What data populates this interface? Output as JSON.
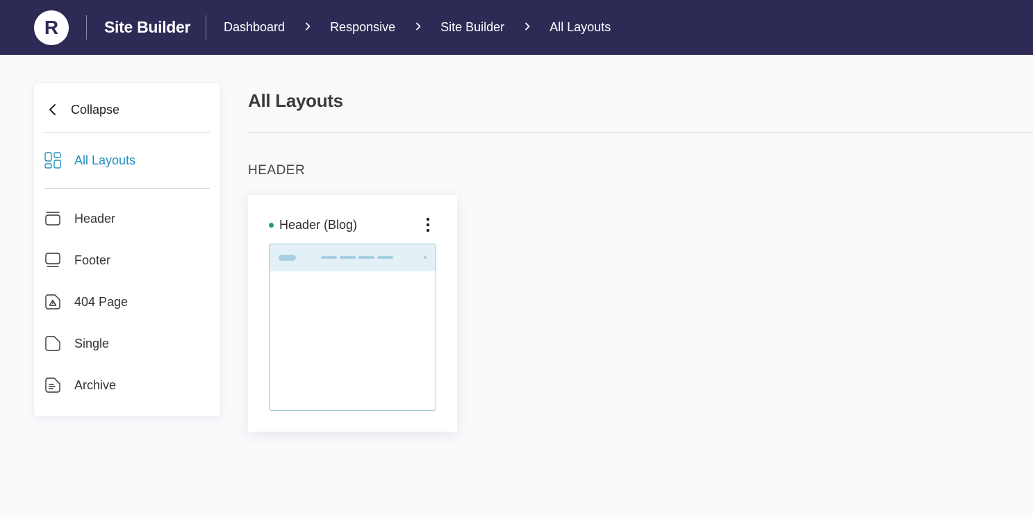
{
  "topbar": {
    "logo_letter": "R",
    "app_name": "Site Builder",
    "breadcrumb": [
      "Dashboard",
      "Responsive",
      "Site Builder",
      "All Layouts"
    ],
    "background_color": "#2d2b55"
  },
  "sidebar": {
    "collapse_label": "Collapse",
    "all_layouts_label": "All Layouts",
    "items": [
      {
        "label": "Header",
        "icon": "header-layout-icon"
      },
      {
        "label": "Footer",
        "icon": "footer-layout-icon"
      },
      {
        "label": "404 Page",
        "icon": "warning-page-icon"
      },
      {
        "label": "Single",
        "icon": "single-page-icon"
      },
      {
        "label": "Archive",
        "icon": "archive-page-icon"
      }
    ],
    "active_color": "#1e8fc0"
  },
  "main": {
    "title": "All Layouts",
    "section_label": "HEADER",
    "cards": [
      {
        "title": "Header (Blog)",
        "status_color": "#1fa35b"
      }
    ]
  }
}
